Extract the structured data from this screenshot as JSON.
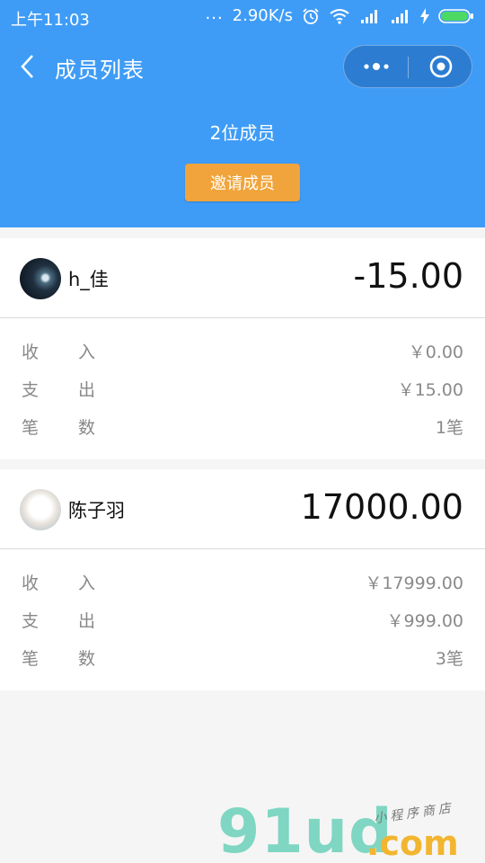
{
  "status_bar": {
    "time": "上午11:03",
    "dots": "...",
    "speed": "2.90K/s"
  },
  "nav": {
    "title": "成员列表"
  },
  "header": {
    "member_count": "2位成员",
    "invite_label": "邀请成员"
  },
  "members": [
    {
      "name": "h_佳",
      "balance": "-15.00",
      "rows": [
        {
          "label_a": "收",
          "label_b": "入",
          "value": "￥0.00"
        },
        {
          "label_a": "支",
          "label_b": "出",
          "value": "￥15.00"
        },
        {
          "label_a": "笔",
          "label_b": "数",
          "value": "1笔"
        }
      ]
    },
    {
      "name": "陈子羽",
      "balance": "17000.00",
      "rows": [
        {
          "label_a": "收",
          "label_b": "入",
          "value": "￥17999.00"
        },
        {
          "label_a": "支",
          "label_b": "出",
          "value": "￥999.00"
        },
        {
          "label_a": "笔",
          "label_b": "数",
          "value": "3笔"
        }
      ]
    }
  ],
  "watermark": {
    "main": "91ud",
    "dot": ".com",
    "sub": "小程序商店"
  },
  "colors": {
    "header_bg": "#3f9cf6",
    "invite_bg": "#f0a43b",
    "page_bg": "#f5f5f5"
  }
}
